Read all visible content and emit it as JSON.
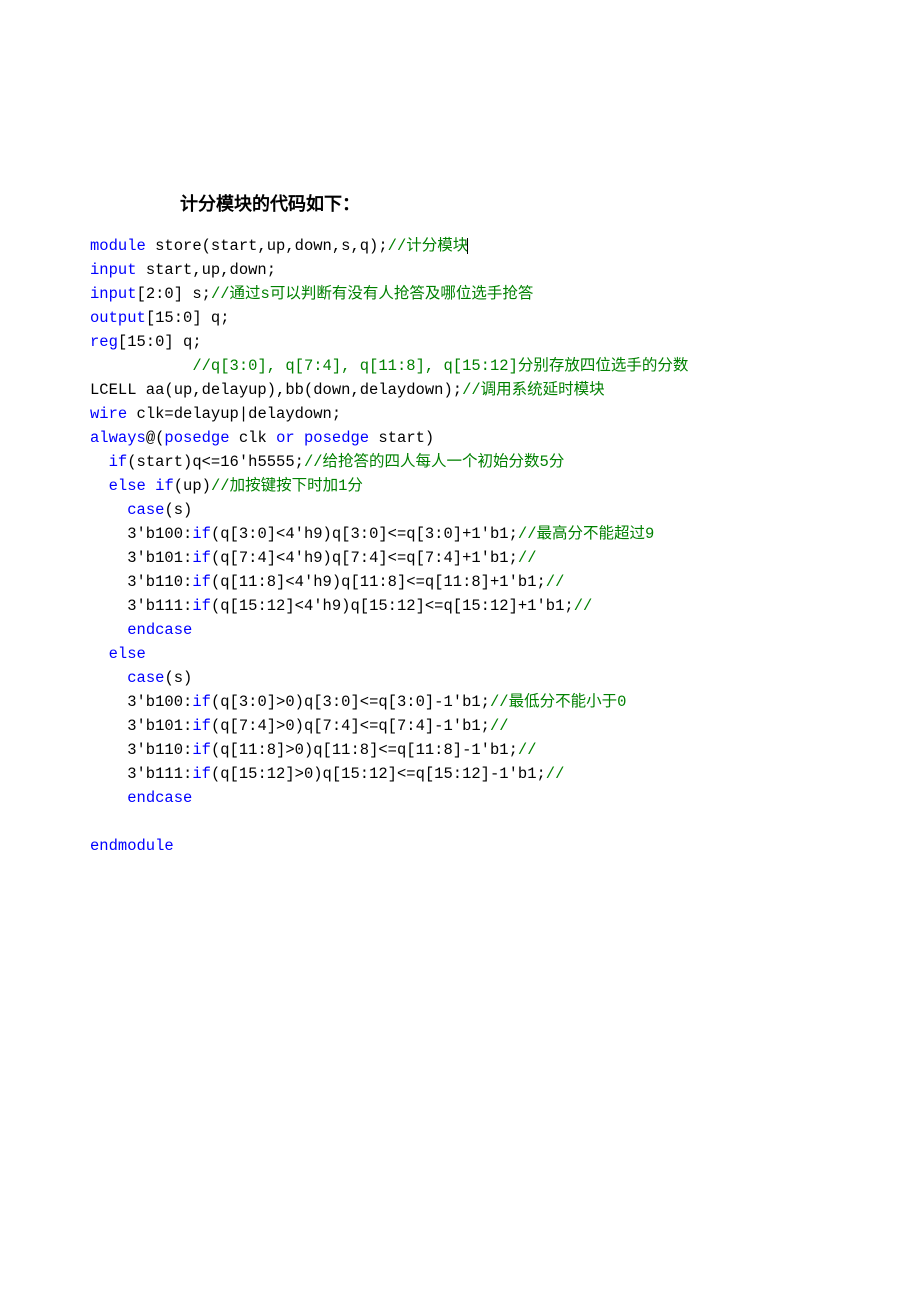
{
  "title": "计分模块的代码如下：",
  "lines": [
    [
      {
        "cls": "kw",
        "t": "module"
      },
      {
        "cls": "blk",
        "t": " store(start,up,down,s,q);"
      },
      {
        "cls": "cmt",
        "t": "//计分模块"
      },
      {
        "cls": "cursor",
        "t": ""
      }
    ],
    [
      {
        "cls": "kw",
        "t": "input"
      },
      {
        "cls": "blk",
        "t": " start,up,down;"
      }
    ],
    [
      {
        "cls": "kw",
        "t": "input"
      },
      {
        "cls": "blk",
        "t": "[2:0] s;"
      },
      {
        "cls": "cmt",
        "t": "//通过s可以判断有没有人抢答及哪位选手抢答"
      }
    ],
    [
      {
        "cls": "kw",
        "t": "output"
      },
      {
        "cls": "blk",
        "t": "[15:0] q;"
      }
    ],
    [
      {
        "cls": "kw",
        "t": "reg"
      },
      {
        "cls": "blk",
        "t": "[15:0] q;"
      }
    ],
    [
      {
        "cls": "blk",
        "t": "           "
      },
      {
        "cls": "cmt",
        "t": "//q[3:0], q[7:4], q[11:8], q[15:12]分别存放四位选手的分数"
      }
    ],
    [
      {
        "cls": "blk",
        "t": "LCELL aa(up,delayup),bb(down,delaydown);"
      },
      {
        "cls": "cmt",
        "t": "//调用系统延时模块"
      }
    ],
    [
      {
        "cls": "kw",
        "t": "wire"
      },
      {
        "cls": "blk",
        "t": " clk=delayup|delaydown;"
      }
    ],
    [
      {
        "cls": "kw",
        "t": "always"
      },
      {
        "cls": "blk",
        "t": "@("
      },
      {
        "cls": "kw",
        "t": "posedge"
      },
      {
        "cls": "blk",
        "t": " clk "
      },
      {
        "cls": "kw",
        "t": "or"
      },
      {
        "cls": "blk",
        "t": " "
      },
      {
        "cls": "kw",
        "t": "posedge"
      },
      {
        "cls": "blk",
        "t": " start)"
      }
    ],
    [
      {
        "cls": "blk",
        "t": "  "
      },
      {
        "cls": "kw",
        "t": "if"
      },
      {
        "cls": "blk",
        "t": "(start)q<=16'h5555;"
      },
      {
        "cls": "cmt",
        "t": "//给抢答的四人每人一个初始分数5分"
      }
    ],
    [
      {
        "cls": "blk",
        "t": "  "
      },
      {
        "cls": "kw",
        "t": "else"
      },
      {
        "cls": "blk",
        "t": " "
      },
      {
        "cls": "kw",
        "t": "if"
      },
      {
        "cls": "blk",
        "t": "(up)"
      },
      {
        "cls": "cmt",
        "t": "//加按键按下时加1分"
      }
    ],
    [
      {
        "cls": "blk",
        "t": "    "
      },
      {
        "cls": "kw",
        "t": "case"
      },
      {
        "cls": "blk",
        "t": "(s)"
      }
    ],
    [
      {
        "cls": "blk",
        "t": "    3'b100:"
      },
      {
        "cls": "kw",
        "t": "if"
      },
      {
        "cls": "blk",
        "t": "(q[3:0]<4'h9)q[3:0]<=q[3:0]+1'b1;"
      },
      {
        "cls": "cmt",
        "t": "//最高分不能超过9"
      }
    ],
    [
      {
        "cls": "blk",
        "t": "    3'b101:"
      },
      {
        "cls": "kw",
        "t": "if"
      },
      {
        "cls": "blk",
        "t": "(q[7:4]<4'h9)q[7:4]<=q[7:4]+1'b1;"
      },
      {
        "cls": "cmt",
        "t": "//"
      }
    ],
    [
      {
        "cls": "blk",
        "t": "    3'b110:"
      },
      {
        "cls": "kw",
        "t": "if"
      },
      {
        "cls": "blk",
        "t": "(q[11:8]<4'h9)q[11:8]<=q[11:8]+1'b1;"
      },
      {
        "cls": "cmt",
        "t": "//"
      }
    ],
    [
      {
        "cls": "blk",
        "t": "    3'b111:"
      },
      {
        "cls": "kw",
        "t": "if"
      },
      {
        "cls": "blk",
        "t": "(q[15:12]<4'h9)q[15:12]<=q[15:12]+1'b1;"
      },
      {
        "cls": "cmt",
        "t": "//"
      }
    ],
    [
      {
        "cls": "blk",
        "t": "    "
      },
      {
        "cls": "kw",
        "t": "endcase"
      }
    ],
    [
      {
        "cls": "blk",
        "t": "  "
      },
      {
        "cls": "kw",
        "t": "else"
      }
    ],
    [
      {
        "cls": "blk",
        "t": "    "
      },
      {
        "cls": "kw",
        "t": "case"
      },
      {
        "cls": "blk",
        "t": "(s)"
      }
    ],
    [
      {
        "cls": "blk",
        "t": "    3'b100:"
      },
      {
        "cls": "kw",
        "t": "if"
      },
      {
        "cls": "blk",
        "t": "(q[3:0]>0)q[3:0]<=q[3:0]-1'b1;"
      },
      {
        "cls": "cmt",
        "t": "//最低分不能小于0"
      }
    ],
    [
      {
        "cls": "blk",
        "t": "    3'b101:"
      },
      {
        "cls": "kw",
        "t": "if"
      },
      {
        "cls": "blk",
        "t": "(q[7:4]>0)q[7:4]<=q[7:4]-1'b1;"
      },
      {
        "cls": "cmt",
        "t": "//"
      }
    ],
    [
      {
        "cls": "blk",
        "t": "    3'b110:"
      },
      {
        "cls": "kw",
        "t": "if"
      },
      {
        "cls": "blk",
        "t": "(q[11:8]>0)q[11:8]<=q[11:8]-1'b1;"
      },
      {
        "cls": "cmt",
        "t": "//"
      }
    ],
    [
      {
        "cls": "blk",
        "t": "    3'b111:"
      },
      {
        "cls": "kw",
        "t": "if"
      },
      {
        "cls": "blk",
        "t": "(q[15:12]>0)q[15:12]<=q[15:12]-1'b1;"
      },
      {
        "cls": "cmt",
        "t": "//"
      }
    ],
    [
      {
        "cls": "blk",
        "t": "    "
      },
      {
        "cls": "kw",
        "t": "endcase"
      }
    ],
    [
      {
        "cls": "blank",
        "t": ""
      }
    ],
    [
      {
        "cls": "kw",
        "t": "endmodule"
      }
    ]
  ]
}
